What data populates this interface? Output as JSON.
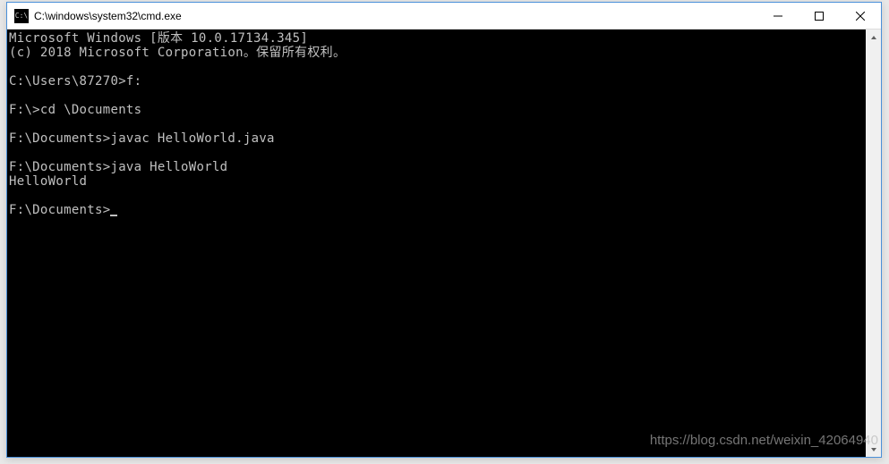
{
  "window": {
    "title": "C:\\windows\\system32\\cmd.exe",
    "icon_label": "C:\\"
  },
  "terminal": {
    "lines": [
      "Microsoft Windows [版本 10.0.17134.345]",
      "(c) 2018 Microsoft Corporation。保留所有权利。",
      "",
      "C:\\Users\\87270>f:",
      "",
      "F:\\>cd \\Documents",
      "",
      "F:\\Documents>javac HelloWorld.java",
      "",
      "F:\\Documents>java HelloWorld",
      "HelloWorld",
      "",
      "F:\\Documents>"
    ]
  },
  "watermark": "https://blog.csdn.net/weixin_42064940"
}
